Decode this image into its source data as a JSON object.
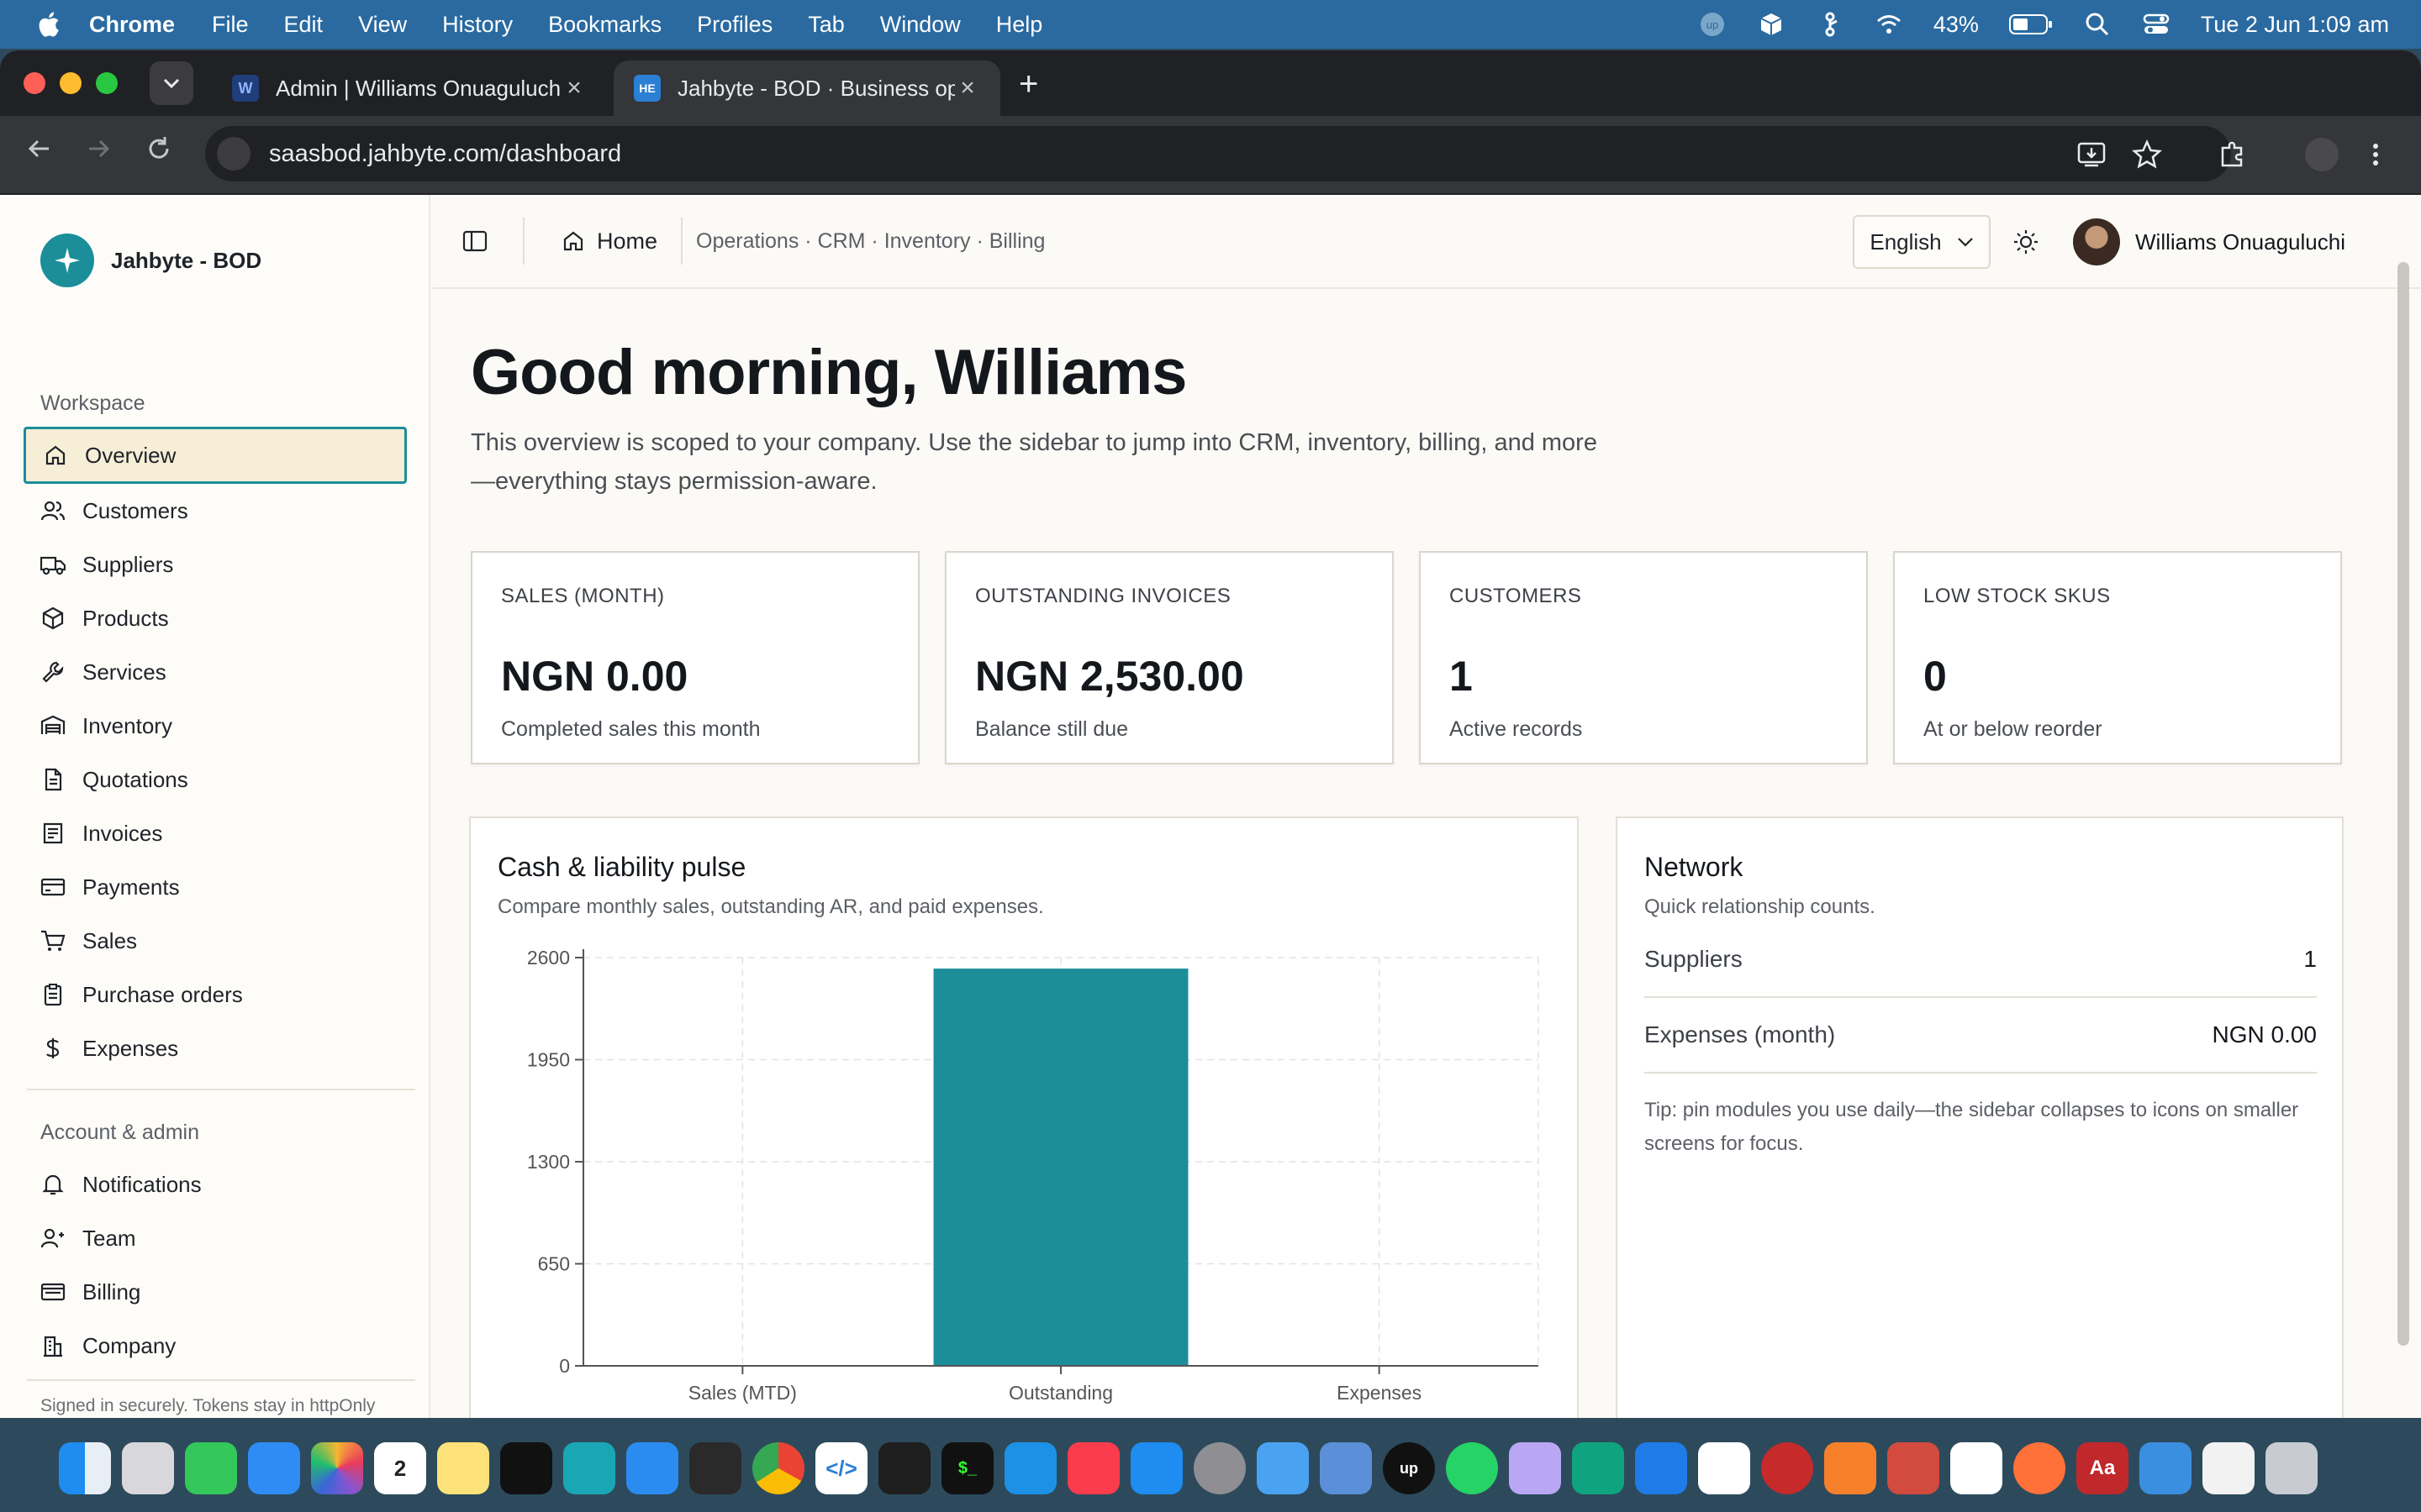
{
  "menubar": {
    "app_name": "Chrome",
    "items": [
      "File",
      "Edit",
      "View",
      "History",
      "Bookmarks",
      "Profiles",
      "Tab",
      "Window",
      "Help"
    ],
    "battery": "43%",
    "datetime": "Tue 2 Jun  1:09 am"
  },
  "browser": {
    "tabs": [
      {
        "title": "Admin | Williams Onuaguluchi",
        "favicon": "W"
      },
      {
        "title": "Jahbyte - BOD · Business ope",
        "favicon": "HE"
      }
    ],
    "url": "saasbod.jahbyte.com/dashboard"
  },
  "sidebar": {
    "brand": "Jahbyte - BOD",
    "workspace_label": "Workspace",
    "workspace_items": [
      {
        "label": "Overview",
        "icon": "home-icon"
      },
      {
        "label": "Customers",
        "icon": "users-icon"
      },
      {
        "label": "Suppliers",
        "icon": "truck-icon"
      },
      {
        "label": "Products",
        "icon": "box-icon"
      },
      {
        "label": "Services",
        "icon": "wrench-icon"
      },
      {
        "label": "Inventory",
        "icon": "warehouse-icon"
      },
      {
        "label": "Quotations",
        "icon": "document-icon"
      },
      {
        "label": "Invoices",
        "icon": "receipt-icon"
      },
      {
        "label": "Payments",
        "icon": "card-icon"
      },
      {
        "label": "Sales",
        "icon": "cart-icon"
      },
      {
        "label": "Purchase orders",
        "icon": "clipboard-icon"
      },
      {
        "label": "Expenses",
        "icon": "dollar-icon"
      }
    ],
    "admin_label": "Account & admin",
    "admin_items": [
      {
        "label": "Notifications",
        "icon": "bell-icon"
      },
      {
        "label": "Team",
        "icon": "team-icon"
      },
      {
        "label": "Billing",
        "icon": "billing-icon"
      },
      {
        "label": "Company",
        "icon": "building-icon"
      }
    ],
    "footer": "Signed in securely. Tokens stay in httpOnly cookies."
  },
  "topbar": {
    "home": "Home",
    "path": "Operations · CRM · Inventory · Billing",
    "language": "English",
    "user": "Williams Onuaguluchi"
  },
  "main": {
    "greeting": "Good morning, Williams",
    "intro": "This overview is scoped to your company. Use the sidebar to jump into CRM, inventory, billing, and more—everything stays permission-aware.",
    "stats": [
      {
        "label": "SALES (MONTH)",
        "value": "NGN 0.00",
        "sub": "Completed sales this month"
      },
      {
        "label": "OUTSTANDING INVOICES",
        "value": "NGN 2,530.00",
        "sub": "Balance still due"
      },
      {
        "label": "CUSTOMERS",
        "value": "1",
        "sub": "Active records"
      },
      {
        "label": "LOW STOCK SKUS",
        "value": "0",
        "sub": "At or below reorder"
      }
    ],
    "chart_panel": {
      "title": "Cash & liability pulse",
      "subtitle": "Compare monthly sales, outstanding AR, and paid expenses."
    },
    "network": {
      "title": "Network",
      "subtitle": "Quick relationship counts.",
      "rows": [
        {
          "label": "Suppliers",
          "value": "1"
        },
        {
          "label": "Expenses (month)",
          "value": "NGN 0.00"
        }
      ],
      "tip": "Tip: pin modules you use daily—the sidebar collapses to icons on smaller screens for focus."
    }
  },
  "chart_data": {
    "type": "bar",
    "categories": [
      "Sales (MTD)",
      "Outstanding",
      "Expenses"
    ],
    "values": [
      0,
      2530,
      0
    ],
    "yticks": [
      0,
      650,
      1300,
      1950,
      2600
    ],
    "ylim": [
      0,
      2600
    ],
    "bar_color": "#1b8e9a",
    "grid": true
  },
  "colors": {
    "accent": "#1b8e9a",
    "active_bg": "#f6eed6"
  }
}
